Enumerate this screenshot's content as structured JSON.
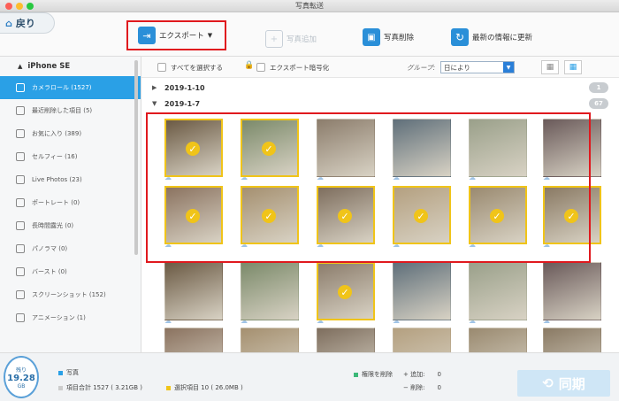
{
  "window": {
    "title": "写真転送"
  },
  "toolbar": {
    "back_label": "戻り",
    "export_label": "エクスポート",
    "add_label": "写真追加",
    "delete_label": "写真削除",
    "refresh_label": "最新の情報に更新"
  },
  "sidebar": {
    "device": "iPhone SE",
    "items": [
      {
        "label": "カメラロール (1527)",
        "icon": "camera-icon"
      },
      {
        "label": "最近削除した項目 (5)",
        "icon": "trash-icon"
      },
      {
        "label": "お気に入り (389)",
        "icon": "heart-icon"
      },
      {
        "label": "セルフィー (16)",
        "icon": "selfie-icon"
      },
      {
        "label": "Live Photos (23)",
        "icon": "live-icon"
      },
      {
        "label": "ポートレート (0)",
        "icon": "cube-icon"
      },
      {
        "label": "長時間露光 (0)",
        "icon": "exposure-icon"
      },
      {
        "label": "パノラマ (0)",
        "icon": "panorama-icon"
      },
      {
        "label": "バースト (0)",
        "icon": "burst-icon"
      },
      {
        "label": "スクリーンショット (152)",
        "icon": "screenshot-icon"
      },
      {
        "label": "アニメーション (1)",
        "icon": "animation-icon"
      }
    ]
  },
  "filters": {
    "select_all": "すべてを選択する",
    "encrypt_export": "エクスポート暗号化",
    "group_label": "グループ:",
    "group_value": "日により"
  },
  "groups": [
    {
      "date": "2019-1-10",
      "count": "1",
      "collapsed": true
    },
    {
      "date": "2019-1-7",
      "count": "67",
      "collapsed": false
    }
  ],
  "status": {
    "storage_label": "残り",
    "storage_value": "19.28",
    "storage_unit": "GB",
    "photo_label": "写真",
    "total_label": "項目合計 1527 ( 3.21GB )",
    "selected_label": "選択項目 10 ( 26.0MB )",
    "perm_delete_label": "権限を削除",
    "add_label": "+ 追加:",
    "add_value": "0",
    "remove_label": "− 削除:",
    "remove_value": "0",
    "sync_label": "同期"
  },
  "colors": {
    "accent": "#2aa0e6",
    "selected": "#f0c419",
    "highlight": "#e0191e"
  }
}
